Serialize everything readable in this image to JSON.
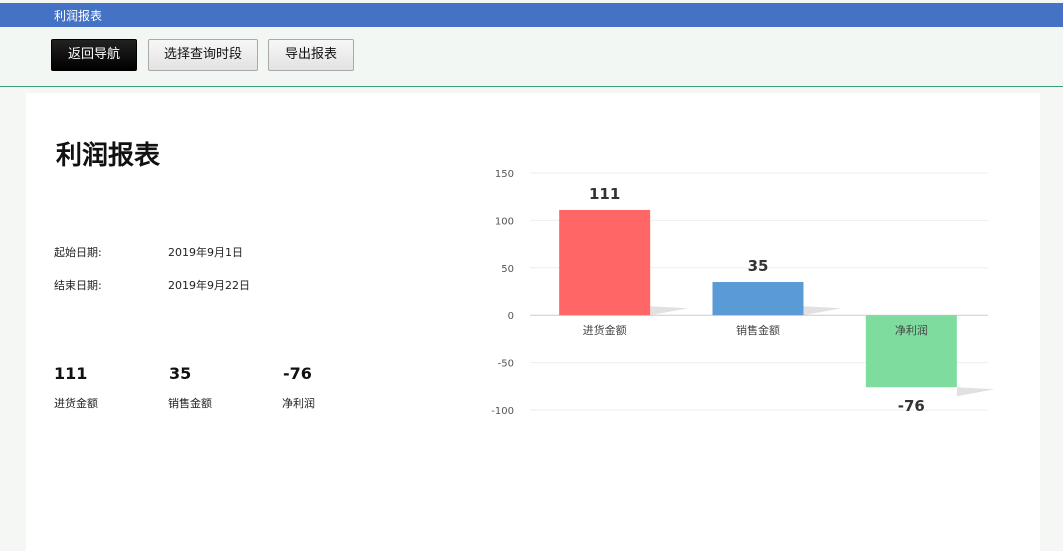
{
  "window": {
    "title": "利润报表"
  },
  "toolbar": {
    "back_label": "返回导航",
    "period_label": "选择查询时段",
    "export_label": "导出报表"
  },
  "report": {
    "title": "利润报表",
    "start_label": "起始日期:",
    "start_value": "2019年9月1日",
    "end_label": "结束日期:",
    "end_value": "2019年9月22日",
    "summary": [
      {
        "value": "111",
        "label": "进货金额"
      },
      {
        "value": "35",
        "label": "销售金额"
      },
      {
        "value": "-76",
        "label": "净利润"
      }
    ]
  },
  "chart_data": {
    "type": "bar",
    "categories": [
      "进货金额",
      "销售金额",
      "净利润"
    ],
    "values": [
      111,
      35,
      -76
    ],
    "ylim": [
      -100,
      150
    ],
    "yticks": [
      150,
      100,
      50,
      0,
      -50,
      -100
    ],
    "colors": [
      "#ff6666",
      "#5b9bd5",
      "#7fdc9f"
    ],
    "grid": true
  }
}
